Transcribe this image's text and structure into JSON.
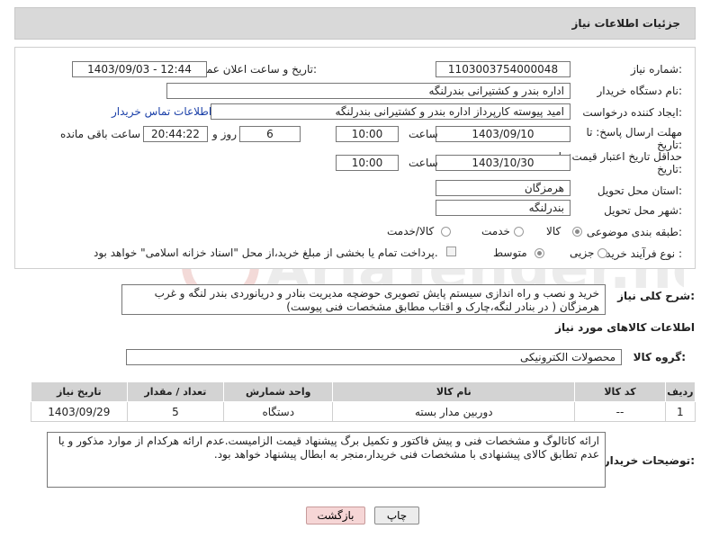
{
  "page": {
    "title": "جزئیات اطلاعات نیاز"
  },
  "labels": {
    "need_number": "شماره نیاز:",
    "announce_datetime": "تاریخ و ساعت اعلان عمومی:",
    "buyer_org": "نام دستگاه خریدار:",
    "requester": "ایجاد کننده درخواست:",
    "reply_deadline_1": "مهلت ارسال پاسخ: تا",
    "reply_deadline_2": "تاریخ:",
    "time": "ساعت",
    "time2": "ساعت",
    "day_and": "روز و",
    "remaining": "ساعت باقی مانده",
    "price_deadline_1": "حداقل تاریخ اعتبار قیمت: تا",
    "price_deadline_2": "تاریخ:",
    "delivery_province": "استان محل تحویل:",
    "delivery_city": "شهر محل تحویل:",
    "category": "طبقه بندی موضوعی:",
    "purchase_type": "نوع فرآیند خرید :",
    "general_desc": "شرح کلی نیاز:",
    "goods_info": "اطلاعات کالاهای مورد نیاز",
    "goods_group": "گروه کالا:",
    "buyer_notes": "توضیحات خریدار:"
  },
  "values": {
    "need_number": "1103003754000048",
    "announce_datetime": "1403/09/03 - 12:44",
    "buyer_org": "اداره بندر و کشتیرانی بندرلنگه",
    "requester": "امید پیوسته کارپرداز اداره بندر و کشتیرانی بندرلنگه",
    "contact_link": "اطلاعات تماس خریدار",
    "reply_date": "1403/09/10",
    "reply_time": "10:00",
    "reply_days": "6",
    "reply_remaining": "20:44:22",
    "price_date": "1403/10/30",
    "price_time": "10:00",
    "province": "هرمزگان",
    "city": "بندرلنگه",
    "general_desc": "خرید و نصب و راه اندازی سیستم پایش تصویری حوضچه مدیریت بنادر و دریانوردی بندر لنگه و غرب هرمزگان ( در بنادر لنگه،چارک و اقتاب مطابق مشخصات فنی پیوست)",
    "goods_group": "محصولات الکترونیکی",
    "buyer_notes": "ارائه کاتالوگ و مشخصات فنی و پیش فاکتور و تکمیل برگ پیشنهاد قیمت الزامیست.عدم ارائه هرکدام از موارد مذکور و یا عدم تطابق کالای پیشنهادی با مشخصات فنی خریدار،منجر به ابطال پیشنهاد خواهد بود."
  },
  "category_options": [
    {
      "label": "کالا",
      "checked": true
    },
    {
      "label": "خدمت",
      "checked": false
    },
    {
      "label": "کالا/خدمت",
      "checked": false
    }
  ],
  "purchase_options": [
    {
      "label": "جزیی",
      "checked": false
    },
    {
      "label": "متوسط",
      "checked": true
    }
  ],
  "payment_note": "پرداخت تمام یا بخشی از مبلغ خرید،از محل \"اسناد خزانه اسلامی\" خواهد بود.",
  "table": {
    "headers": [
      "ردیف",
      "کد کالا",
      "نام کالا",
      "واحد شمارش",
      "تعداد / مقدار",
      "تاریخ نیاز"
    ],
    "rows": [
      [
        "1",
        "--",
        "دوربین مدار بسته",
        "دستگاه",
        "5",
        "1403/09/29"
      ]
    ]
  },
  "buttons": {
    "print": "چاپ",
    "back": "بازگشت"
  },
  "watermark": "AriaTender.neT"
}
